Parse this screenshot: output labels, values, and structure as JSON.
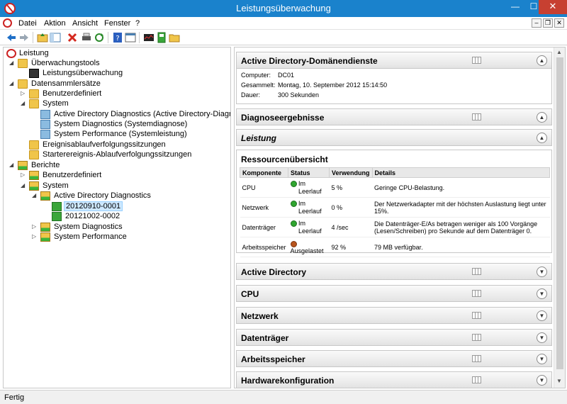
{
  "window": {
    "title": "Leistungsüberwachung"
  },
  "menu": [
    "Datei",
    "Aktion",
    "Ansicht",
    "Fenster",
    "?"
  ],
  "toolbar": [
    "back-icon",
    "forward-icon",
    "up-folder-icon",
    "console-tree-icon",
    "delete-icon",
    "print-icon",
    "refresh-icon",
    "help-icon",
    "properties-icon",
    "performance-monitor-icon",
    "report-icon",
    "folder-icon"
  ],
  "tree": {
    "root": "Leistung",
    "tools": "Überwachungstools",
    "monitor": "Leistungsüberwachung",
    "dcs": "Datensammlersätze",
    "dcs_user": "Benutzerdefiniert",
    "dcs_system": "System",
    "sys1": "Active Directory Diagnostics (Active Directory-Diagnose)",
    "sys2": "System Diagnostics (Systemdiagnose)",
    "sys3": "System Performance (Systemleistung)",
    "trace": "Ereignisablaufverfolgungssitzungen",
    "startup": "Starterereignis-Ablaufverfolgungssitzungen",
    "reports": "Berichte",
    "rep_user": "Benutzerdefiniert",
    "rep_system": "System",
    "rep_ad": "Active Directory Diagnostics",
    "rep_ad_1": "20120910-0001",
    "rep_ad_2": "20121002-0002",
    "rep_sysdiag": "System Diagnostics",
    "rep_sysperf": "System Performance"
  },
  "report": {
    "title": "Active Directory-Domänendienste",
    "computer_label": "Computer:",
    "computer": "DC01",
    "collected_label": "Gesammelt:",
    "collected": "Montag, 10. September 2012 15:14:50",
    "duration_label": "Dauer:",
    "duration": "300 Sekunden",
    "diag": "Diagnoseergebnisse",
    "perf": "Leistung",
    "res_title": "Ressourcenübersicht",
    "headers": [
      "Komponente",
      "Status",
      "Verwendung",
      "Details"
    ],
    "rows": [
      {
        "comp": "CPU",
        "status1": "Im",
        "status2": "Leerlauf",
        "usage": "5 %",
        "details": "Geringe CPU-Belastung."
      },
      {
        "comp": "Netzwerk",
        "status1": "Im",
        "status2": "Leerlauf",
        "usage": "0 %",
        "details": "Der Netzwerkadapter mit der höchsten Auslastung liegt unter 15%."
      },
      {
        "comp": "Datenträger",
        "status1": "Im",
        "status2": "Leerlauf",
        "usage": "4 /sec",
        "details": "Die Datenträger-E/As betragen weniger als 100 Vorgänge (Lesen/Schreiben) pro Sekunde auf dem Datenträger 0."
      },
      {
        "comp": "Arbeitsspeicher",
        "status1": "",
        "status2": "Ausgelastet",
        "usage": "92 %",
        "details": "79 MB verfügbar."
      }
    ],
    "sections": [
      "Active Directory",
      "CPU",
      "Netzwerk",
      "Datenträger",
      "Arbeitsspeicher",
      "Hardwarekonfiguration"
    ]
  },
  "status": {
    "text": "Fertig"
  }
}
